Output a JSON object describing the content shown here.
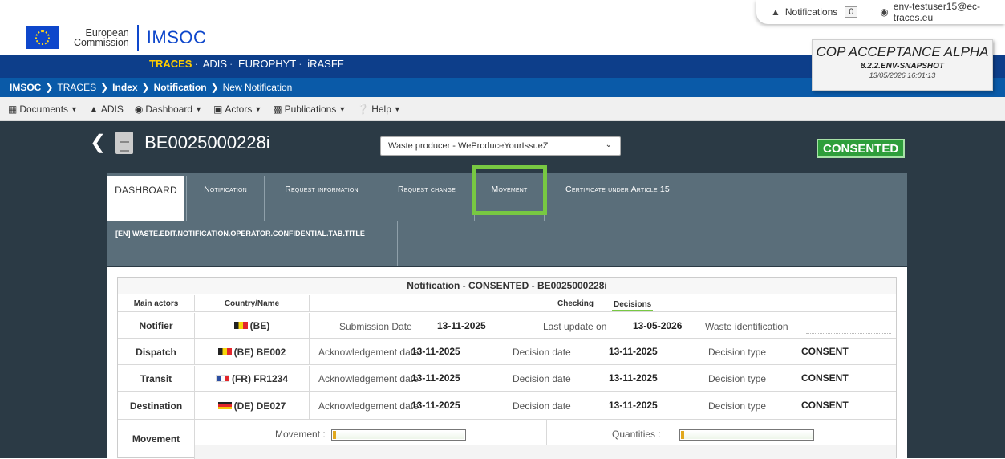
{
  "topbar": {
    "notifications_label": "Notifications",
    "notifications_count": "0",
    "user_email": "env-testuser15@ec-traces.eu"
  },
  "brand": {
    "org_line1": "European",
    "org_line2": "Commission",
    "title": "IMSOC"
  },
  "apps": [
    "TRACES",
    "ADIS",
    "EUROPHYT",
    "iRASFF"
  ],
  "apps_active": "TRACES",
  "breadcrumb": {
    "root": "IMSOC",
    "traces": "TRACES",
    "index": "Index",
    "notification": "Notification",
    "current": "New Notification"
  },
  "env": {
    "name": "COP ACCEPTANCE ALPHA",
    "version": "8.2.2.ENV-SNAPSHOT",
    "timestamp": "13/05/2026 16:01:13"
  },
  "menu": {
    "documents": "Documents",
    "adis": "ADIS",
    "dashboard": "Dashboard",
    "actors": "Actors",
    "publications": "Publications",
    "help": "Help"
  },
  "document": {
    "id": "BE0025000228i",
    "operator": "Waste producer - WeProduceYourIssueZ",
    "status": "CONSENTED"
  },
  "tabs": {
    "dashboard": "DASHBOARD",
    "notification": "Notification",
    "request_information": "Request information",
    "request_change": "Request change",
    "movement": "Movement",
    "certificate": "Certificate under Article 15"
  },
  "subtab": {
    "label": "[EN] WASTE.EDIT.NOTIFICATION.OPERATOR.CONFIDENTIAL.TAB.TITLE"
  },
  "summary": {
    "title": "Notification - CONSENTED - BE0025000228i",
    "col_main_actors": "Main actors",
    "col_country_name": "Country/Name",
    "checking": "Checking",
    "decisions": "Decisions",
    "notifier": {
      "label": "Notifier",
      "country": "(BE)",
      "submission_label": "Submission Date",
      "submission_value": "13-11-2025",
      "last_update_label": "Last update on",
      "last_update_value": "13-05-2026",
      "waste_id_label": "Waste identification"
    },
    "rows": [
      {
        "label": "Dispatch",
        "country": "(BE) BE002",
        "ack_label": "Acknowledgement date",
        "ack_value": "13-11-2025",
        "decision_label": "Decision date",
        "decision_value": "13-11-2025",
        "type_label": "Decision type",
        "type_value": "CONSENT"
      },
      {
        "label": "Transit",
        "country": "(FR) FR1234",
        "ack_label": "Acknowledgement date",
        "ack_value": "13-11-2025",
        "decision_label": "Decision date",
        "decision_value": "13-11-2025",
        "type_label": "Decision type",
        "type_value": "CONSENT"
      },
      {
        "label": "Destination",
        "country": "(DE) DE027",
        "ack_label": "Acknowledgement date",
        "ack_value": "13-11-2025",
        "decision_label": "Decision date",
        "decision_value": "13-11-2025",
        "type_label": "Decision type",
        "type_value": "CONSENT"
      }
    ],
    "movement": {
      "label": "Movement",
      "movement_label": "Movement :",
      "quantities_label": "Quantities :"
    }
  }
}
